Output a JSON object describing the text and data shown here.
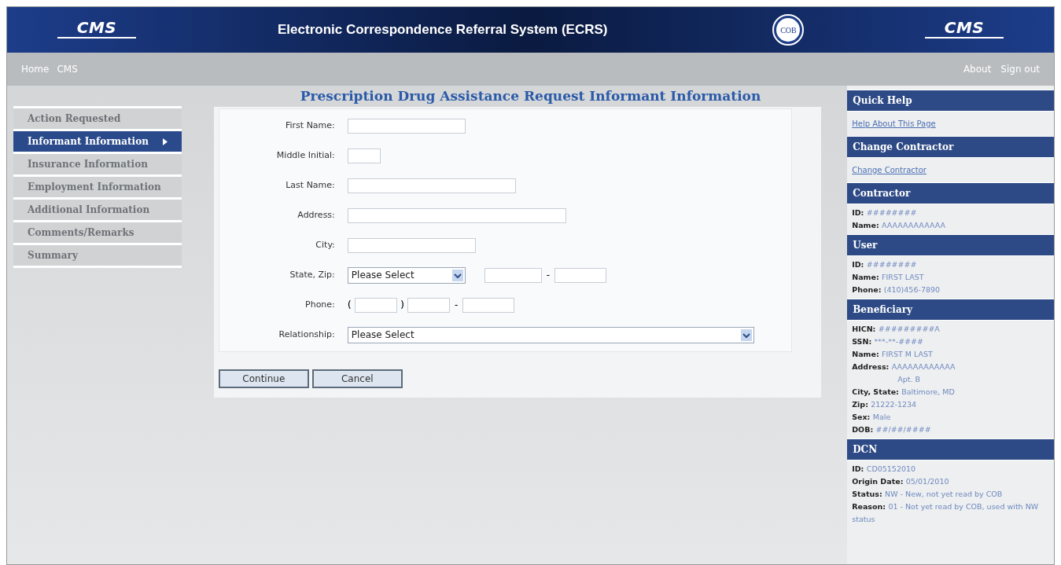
{
  "header": {
    "logo_left": "CMS",
    "title": "Electronic Correspondence Referral System (ECRS)",
    "seal": "COB",
    "logo_right": "CMS"
  },
  "nav": {
    "left": [
      "Home",
      "CMS"
    ],
    "right": [
      "About",
      "Sign out"
    ]
  },
  "page_title": "Prescription Drug Assistance Request Informant Information",
  "sidebar": {
    "items": [
      {
        "label": "Action Requested",
        "selected": false
      },
      {
        "label": "Informant Information",
        "selected": true
      },
      {
        "label": "Insurance Information",
        "selected": false
      },
      {
        "label": "Employment Information",
        "selected": false
      },
      {
        "label": "Additional Information",
        "selected": false
      },
      {
        "label": "Comments/Remarks",
        "selected": false
      },
      {
        "label": "Summary",
        "selected": false
      }
    ]
  },
  "form": {
    "rows": [
      {
        "label": "First Name:",
        "kind": "text"
      },
      {
        "label": "Middle Initial:",
        "kind": "text"
      },
      {
        "label": "Last Name:",
        "kind": "text"
      },
      {
        "label": "Address:",
        "kind": "text"
      },
      {
        "label": "City:",
        "kind": "text"
      },
      {
        "label": "State, Zip:",
        "kind": "state_zip",
        "value": "Please Select",
        "separators": [
          "-"
        ]
      },
      {
        "label": "Phone:",
        "kind": "phone",
        "separators": [
          "(",
          ")",
          "-"
        ]
      },
      {
        "label": "Relationship:",
        "kind": "select",
        "value": "Please Select"
      }
    ],
    "buttons": [
      "Continue",
      "Cancel"
    ]
  },
  "right_panel": [
    {
      "title": "Quick Help",
      "links": [
        "Help About This Page"
      ]
    },
    {
      "title": "Change Contractor",
      "links": [
        "Change Contractor"
      ]
    },
    {
      "title": "Contractor",
      "fields": [
        {
          "label": "ID:",
          "value": "########"
        },
        {
          "label": "Name:",
          "value": "AAAAAAAAAAAA"
        }
      ]
    },
    {
      "title": "User",
      "fields": [
        {
          "label": "ID:",
          "value": "########"
        },
        {
          "label": "Name:",
          "value": "FIRST LAST"
        },
        {
          "label": "Phone:",
          "value": "(410)456-7890"
        }
      ]
    },
    {
      "title": "Beneficiary",
      "fields": [
        {
          "label": "HICN:",
          "value": "#########A"
        },
        {
          "label": "SSN:",
          "value": "***-**-####"
        },
        {
          "label": "Name:",
          "value": "FIRST M LAST"
        },
        {
          "label": "Address:",
          "value": "AAAAAAAAAAAA"
        },
        {
          "value": "Apt. B"
        },
        {
          "label": "City, State:",
          "value": "Baltimore, MD"
        },
        {
          "label": "Zip:",
          "value": "21222-1234"
        },
        {
          "label": "Sex:",
          "value": "Male"
        },
        {
          "label": "DOB:",
          "value": "##/##/####"
        }
      ]
    },
    {
      "title": "DCN",
      "fields": [
        {
          "label": "ID:",
          "value": "CD05152010"
        },
        {
          "label": "Origin Date:",
          "value": "05/01/2010"
        },
        {
          "label": "Status:",
          "value": "NW - New, not yet read by COB"
        },
        {
          "label": "Reason:",
          "value": "01 - Not yet read by COB, used with NW status"
        }
      ]
    }
  ]
}
